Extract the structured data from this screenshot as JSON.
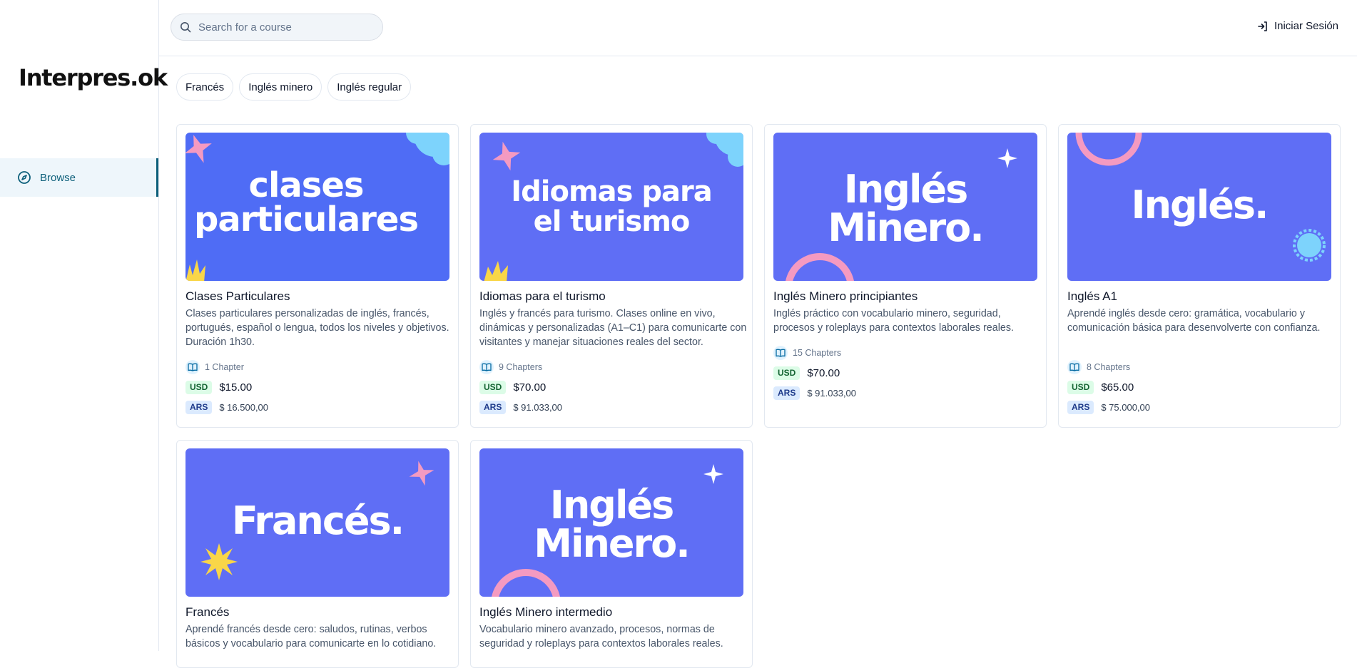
{
  "brand": {
    "logo_text": "Interpres.ok"
  },
  "sidebar": {
    "items": [
      {
        "label": "Browse",
        "icon": "compass-icon"
      }
    ]
  },
  "search": {
    "placeholder": "Search for a course",
    "value": ""
  },
  "header": {
    "login_label": "Iniciar Sesión"
  },
  "categories": [
    "Francés",
    "Inglés minero",
    "Inglés regular"
  ],
  "colors": {
    "accent": "#0c5f7a",
    "thumb_bg": "#5f6ef5",
    "thumb_bg_alt": "#4f6cf5",
    "pink": "#f49ac1",
    "cyan": "#7dd3fc",
    "yellow": "#f9d648"
  },
  "courses": [
    {
      "title": "Clases Particulares",
      "description": "Clases particulares personalizadas de inglés, francés, portugués, español o lengua, todos los niveles y objetivos. Duración 1h30.",
      "chapters": "1 Chapter",
      "usd_label": "USD",
      "usd_price": "$15.00",
      "ars_label": "ARS",
      "ars_price": "$ 16.500,00",
      "thumb_line1": "clases",
      "thumb_line2": "particulares"
    },
    {
      "title": "Idiomas para el turismo",
      "description": "Inglés y francés para turismo. Clases online en vivo, dinámicas y personalizadas (A1–C1) para comunicarte con visitantes y manejar situaciones reales del sector.",
      "chapters": "9 Chapters",
      "usd_label": "USD",
      "usd_price": "$70.00",
      "ars_label": "ARS",
      "ars_price": "$ 91.033,00",
      "thumb_line1": "Idiomas para",
      "thumb_line2": "el turismo"
    },
    {
      "title": "Inglés Minero principiantes",
      "description": "Inglés práctico con vocabulario minero, seguridad, procesos y roleplays para contextos laborales reales.",
      "chapters": "15 Chapters",
      "usd_label": "USD",
      "usd_price": "$70.00",
      "ars_label": "ARS",
      "ars_price": "$ 91.033,00",
      "thumb_line1": "Inglés",
      "thumb_line2": "Minero."
    },
    {
      "title": "Inglés A1",
      "description": "Aprendé inglés desde cero: gramática, vocabulario y comunicación básica para desenvolverte con confianza.",
      "chapters": "8 Chapters",
      "usd_label": "USD",
      "usd_price": "$65.00",
      "ars_label": "ARS",
      "ars_price": "$ 75.000,00",
      "thumb_line1": "Inglés."
    },
    {
      "title": "Francés",
      "description": "Aprendé francés desde cero: saludos, rutinas, verbos básicos y vocabulario para comunicarte en lo cotidiano.",
      "thumb_line1": "Francés."
    },
    {
      "title": "Inglés Minero intermedio",
      "description": "Vocabulario minero avanzado, procesos, normas de seguridad y roleplays para contextos laborales reales.",
      "thumb_line1": "Inglés",
      "thumb_line2": "Minero."
    }
  ]
}
